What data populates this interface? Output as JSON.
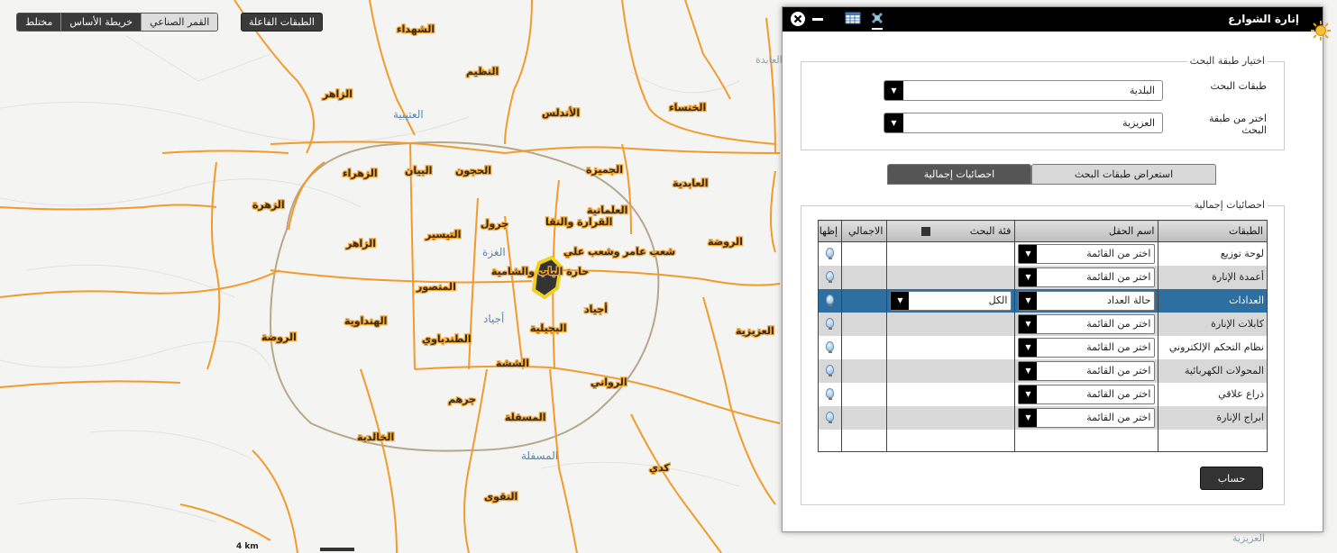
{
  "basemap": {
    "buttons": [
      "مختلط",
      "خريطة الأساس",
      "القمر الصناعي"
    ],
    "layers_button": "الطبقات الفاعلة",
    "scale": "4 km"
  },
  "map": {
    "district_labels": [
      "الشهداء",
      "النظيم",
      "الزاهر",
      "الأندلس",
      "الخنساء",
      "الزهراء",
      "البيان",
      "الحجون",
      "الجميزة",
      "العابدية",
      "الزهرة",
      "الزاهر",
      "التيسير",
      "جرول",
      "القرارة والنقا",
      "العلمانية",
      "الروضة",
      "شعب عامر وشعب علي",
      "حارة الباب والشامية",
      "المنصور",
      "الهنداوية",
      "أجياد",
      "الروضة",
      "الطندباوي",
      "البجيلية",
      "العزيزية",
      "الششة",
      "الرواني",
      "جرهم",
      "المسفلة",
      "الخالدية",
      "كدي",
      "النقوى"
    ],
    "blue_labels": [
      "العتيبية",
      "الغزة",
      "أجياد",
      "المسفلة"
    ],
    "gray_labels": [
      "العابدة",
      "العزيزية"
    ]
  },
  "panel": {
    "title": "إنارة الشوارع",
    "search_section": {
      "legend": "اختيار طبقة البحث",
      "layer_label": "طبقات البحث",
      "layer_value": "البلدية",
      "sublayer_label": "اختر من طبقة البحث",
      "sublayer_value": "العزيزية"
    },
    "tabs": [
      "استعراض طبقات البحث",
      "احصائيات إجمالية"
    ],
    "stats_section": {
      "legend": "احصائيات إجمالية",
      "columns": [
        "الطبقات",
        "اسم الحقل",
        "فئة البحث",
        "الاجمالي",
        "إظهار"
      ],
      "rows": [
        {
          "layer": "لوحة توزيع",
          "field": "اختر من القائمة",
          "category": "",
          "total": ""
        },
        {
          "layer": "أعمدة الإنارة",
          "field": "اختر من القائمة",
          "category": "",
          "total": ""
        },
        {
          "layer": "العدادات",
          "field": "حالة العداد",
          "category": "الكل",
          "total": ""
        },
        {
          "layer": "كابلات الإنارة",
          "field": "اختر من القائمة",
          "category": "",
          "total": ""
        },
        {
          "layer": "نظام التحكم الإلكتروني",
          "field": "اختر من القائمة",
          "category": "",
          "total": ""
        },
        {
          "layer": "المحولات الكهربائية",
          "field": "اختر من القائمة",
          "category": "",
          "total": ""
        },
        {
          "layer": "ذراع علاقي",
          "field": "اختر من القائمة",
          "category": "",
          "total": ""
        },
        {
          "layer": "ابراج الإنارة",
          "field": "اختر من القائمة",
          "category": "",
          "total": ""
        }
      ],
      "calc_button": "حساب"
    }
  },
  "colors": {
    "road": "#f39a2c",
    "ring_road": "#b5a88c",
    "panel_header": "#000000",
    "selected_row": "#2d6fa0"
  }
}
